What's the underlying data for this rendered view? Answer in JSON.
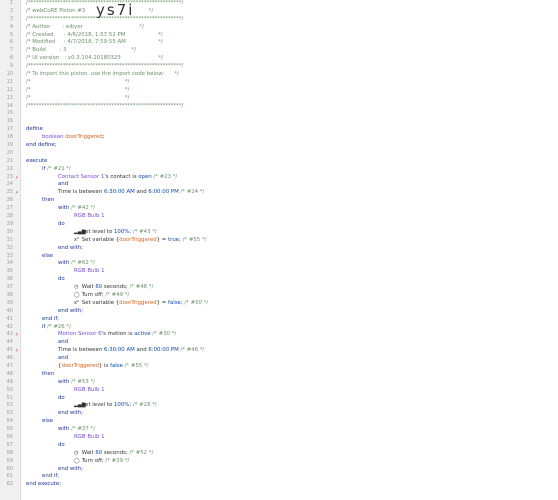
{
  "editor": {
    "import_code": "ys7i",
    "lines": [
      {
        "n": "1",
        "m": "",
        "ind": 0,
        "tokens": [
          [
            "cmt",
            "/*********************************************************/"
          ]
        ]
      },
      {
        "n": "2",
        "m": "",
        "ind": 0,
        "tokens": [
          [
            "cmt",
            "/* webCoRE Piston #3                                     */"
          ]
        ]
      },
      {
        "n": "3",
        "m": "",
        "ind": 0,
        "tokens": [
          [
            "cmt",
            "/*********************************************************/"
          ]
        ]
      },
      {
        "n": "4",
        "m": "",
        "ind": 0,
        "tokens": [
          [
            "cmt",
            "/* Author       : eibyer                                 */"
          ]
        ]
      },
      {
        "n": "5",
        "m": "",
        "ind": 0,
        "tokens": [
          [
            "cmt",
            "/* Created      : 4/6/2018, 1:57:52 PM                   */"
          ]
        ]
      },
      {
        "n": "6",
        "m": "",
        "ind": 0,
        "tokens": [
          [
            "cmt",
            "/* Modified     : 4/7/2018, 7:59:55 AM                   */"
          ]
        ]
      },
      {
        "n": "7",
        "m": "",
        "ind": 0,
        "tokens": [
          [
            "cmt",
            "/* Build        : 3                                      */"
          ]
        ]
      },
      {
        "n": "8",
        "m": "",
        "ind": 0,
        "tokens": [
          [
            "cmt",
            "/* UI version   : v0.3.104.20180323                      */"
          ]
        ]
      },
      {
        "n": "9",
        "m": "",
        "ind": 0,
        "tokens": [
          [
            "cmt",
            "/*********************************************************/"
          ]
        ]
      },
      {
        "n": "10",
        "m": "",
        "ind": 0,
        "tokens": [
          [
            "cmt",
            "/* To import this piston, use the import code below:      */"
          ]
        ]
      },
      {
        "n": "11",
        "m": "",
        "ind": 0,
        "tokens": [
          [
            "cmt",
            "/*                                                       */"
          ]
        ]
      },
      {
        "n": "12",
        "m": "",
        "ind": 0,
        "tokens": [
          [
            "cmt",
            "/*                                                       */"
          ]
        ]
      },
      {
        "n": "13",
        "m": "",
        "ind": 0,
        "tokens": [
          [
            "cmt",
            "/*                                                       */"
          ]
        ]
      },
      {
        "n": "14",
        "m": "",
        "ind": 0,
        "tokens": [
          [
            "cmt",
            "/*********************************************************/"
          ]
        ]
      },
      {
        "n": "15",
        "m": "",
        "ind": 0,
        "tokens": []
      },
      {
        "n": "16",
        "m": "",
        "ind": 0,
        "tokens": []
      },
      {
        "n": "17",
        "m": "",
        "ind": 0,
        "tokens": [
          [
            "kw",
            "define"
          ]
        ]
      },
      {
        "n": "18",
        "m": "",
        "ind": 1,
        "tokens": [
          [
            "tp",
            "boolean "
          ],
          [
            "var",
            "doorTriggered"
          ],
          [
            "op",
            ";"
          ]
        ]
      },
      {
        "n": "19",
        "m": "",
        "ind": 0,
        "tokens": [
          [
            "kw",
            "end define;"
          ]
        ]
      },
      {
        "n": "20",
        "m": "",
        "ind": 0,
        "tokens": []
      },
      {
        "n": "21",
        "m": "",
        "ind": 0,
        "tokens": [
          [
            "kw",
            "execute"
          ]
        ]
      },
      {
        "n": "22",
        "m": "",
        "ind": 1,
        "tokens": [
          [
            "kw",
            "if "
          ],
          [
            "cmt",
            "/* #21 */"
          ]
        ]
      },
      {
        "n": "23",
        "m": "⚡",
        "ind": 2,
        "tokens": [
          [
            "dev",
            "Contact Sensor 1"
          ],
          [
            "op",
            "'s contact is "
          ],
          [
            "val",
            "open"
          ],
          [
            "cmt",
            " /* #23 */"
          ]
        ]
      },
      {
        "n": "24",
        "m": "",
        "ind": 2,
        "tokens": [
          [
            "kw",
            "and"
          ]
        ]
      },
      {
        "n": "25",
        "m": "⚡",
        "ind": 2,
        "tokens": [
          [
            "op",
            "Time is between "
          ],
          [
            "val",
            "6:30:00 AM"
          ],
          [
            "op",
            " and "
          ],
          [
            "val",
            "6:00:00 PM"
          ],
          [
            "cmt",
            " /* #24 */"
          ]
        ]
      },
      {
        "n": "26",
        "m": "",
        "ind": 1,
        "tokens": [
          [
            "kw",
            "then"
          ]
        ]
      },
      {
        "n": "27",
        "m": "",
        "ind": 2,
        "tokens": [
          [
            "kw",
            "with "
          ],
          [
            "cmt",
            "/* #42 */"
          ]
        ]
      },
      {
        "n": "28",
        "m": "",
        "ind": 3,
        "tokens": [
          [
            "dev",
            "RGB Bulb 1"
          ]
        ]
      },
      {
        "n": "29",
        "m": "",
        "ind": 2,
        "tokens": [
          [
            "kw",
            "do"
          ]
        ]
      },
      {
        "n": "30",
        "m": "",
        "ind": 3,
        "tokens": [
          [
            "ico",
            "▂▄▆"
          ],
          [
            "op",
            " Set level to "
          ],
          [
            "val",
            "100%"
          ],
          [
            "op",
            ";"
          ],
          [
            "cmt",
            " /* #43 */"
          ]
        ]
      },
      {
        "n": "31",
        "m": "",
        "ind": 3,
        "tokens": [
          [
            "ico",
            "x²"
          ],
          [
            "op",
            " Set variable {"
          ],
          [
            "var",
            "doorTriggered"
          ],
          [
            "op",
            "} = "
          ],
          [
            "val",
            "true"
          ],
          [
            "op",
            ";"
          ],
          [
            "cmt",
            " /* #55 */"
          ]
        ]
      },
      {
        "n": "32",
        "m": "",
        "ind": 2,
        "tokens": [
          [
            "kw",
            "end with;"
          ]
        ]
      },
      {
        "n": "33",
        "m": "",
        "ind": 1,
        "tokens": [
          [
            "kw",
            "else"
          ]
        ]
      },
      {
        "n": "34",
        "m": "",
        "ind": 2,
        "tokens": [
          [
            "kw",
            "with "
          ],
          [
            "cmt",
            "/* #62 */"
          ]
        ]
      },
      {
        "n": "35",
        "m": "",
        "ind": 3,
        "tokens": [
          [
            "dev",
            "RGB Bulb 1"
          ]
        ]
      },
      {
        "n": "36",
        "m": "",
        "ind": 2,
        "tokens": [
          [
            "kw",
            "do"
          ]
        ]
      },
      {
        "n": "37",
        "m": "",
        "ind": 3,
        "tokens": [
          [
            "ico",
            "◷"
          ],
          [
            "op",
            " Wait "
          ],
          [
            "val",
            "60"
          ],
          [
            "op",
            " seconds;"
          ],
          [
            "cmt",
            " /* #48 */"
          ]
        ]
      },
      {
        "n": "38",
        "m": "",
        "ind": 3,
        "tokens": [
          [
            "ico",
            "◯"
          ],
          [
            "op",
            " Turn off;"
          ],
          [
            "cmt",
            " /* #49 */"
          ]
        ]
      },
      {
        "n": "39",
        "m": "",
        "ind": 3,
        "tokens": [
          [
            "ico",
            "x²"
          ],
          [
            "op",
            " Set variable {"
          ],
          [
            "var",
            "doorTriggered"
          ],
          [
            "op",
            "} = "
          ],
          [
            "val",
            "false"
          ],
          [
            "op",
            ";"
          ],
          [
            "cmt",
            " /* #50 */"
          ]
        ]
      },
      {
        "n": "40",
        "m": "",
        "ind": 2,
        "tokens": [
          [
            "kw",
            "end with;"
          ]
        ]
      },
      {
        "n": "41",
        "m": "",
        "ind": 1,
        "tokens": [
          [
            "kw",
            "end if;"
          ]
        ]
      },
      {
        "n": "42",
        "m": "",
        "ind": 1,
        "tokens": [
          [
            "kw",
            "if "
          ],
          [
            "cmt",
            "/* #26 */"
          ]
        ]
      },
      {
        "n": "43",
        "m": "⚡",
        "ind": 2,
        "tokens": [
          [
            "dev",
            "Motion Sensor 6"
          ],
          [
            "op",
            "'s motion is "
          ],
          [
            "val",
            "active"
          ],
          [
            "cmt",
            " /* #30 */"
          ]
        ]
      },
      {
        "n": "44",
        "m": "",
        "ind": 2,
        "tokens": [
          [
            "kw",
            "and"
          ]
        ]
      },
      {
        "n": "45",
        "m": "⚡",
        "ind": 2,
        "tokens": [
          [
            "op",
            "Time is between "
          ],
          [
            "val",
            "6:30:00 AM"
          ],
          [
            "op",
            " and "
          ],
          [
            "val",
            "6:00:00 PM"
          ],
          [
            "cmt",
            " /* #46 */"
          ]
        ]
      },
      {
        "n": "46",
        "m": "",
        "ind": 2,
        "tokens": [
          [
            "kw",
            "and"
          ]
        ]
      },
      {
        "n": "47",
        "m": "",
        "ind": 2,
        "tokens": [
          [
            "op",
            "{"
          ],
          [
            "var",
            "doorTriggered"
          ],
          [
            "op",
            "} is "
          ],
          [
            "val",
            "false"
          ],
          [
            "cmt",
            " /* #55 */"
          ]
        ]
      },
      {
        "n": "48",
        "m": "",
        "ind": 1,
        "tokens": [
          [
            "kw",
            "then"
          ]
        ]
      },
      {
        "n": "49",
        "m": "",
        "ind": 2,
        "tokens": [
          [
            "kw",
            "with "
          ],
          [
            "cmt",
            "/* #53 */"
          ]
        ]
      },
      {
        "n": "50",
        "m": "",
        "ind": 3,
        "tokens": [
          [
            "dev",
            "RGB Bulb 1"
          ]
        ]
      },
      {
        "n": "51",
        "m": "",
        "ind": 2,
        "tokens": [
          [
            "kw",
            "do"
          ]
        ]
      },
      {
        "n": "52",
        "m": "",
        "ind": 3,
        "tokens": [
          [
            "ico",
            "▂▄▆"
          ],
          [
            "op",
            " Set level to "
          ],
          [
            "val",
            "100%"
          ],
          [
            "op",
            ";"
          ],
          [
            "cmt",
            " /* #28 */"
          ]
        ]
      },
      {
        "n": "53",
        "m": "",
        "ind": 2,
        "tokens": [
          [
            "kw",
            "end with;"
          ]
        ]
      },
      {
        "n": "54",
        "m": "",
        "ind": 1,
        "tokens": [
          [
            "kw",
            "else"
          ]
        ]
      },
      {
        "n": "55",
        "m": "",
        "ind": 2,
        "tokens": [
          [
            "kw",
            "with "
          ],
          [
            "cmt",
            "/* #37 */"
          ]
        ]
      },
      {
        "n": "56",
        "m": "",
        "ind": 3,
        "tokens": [
          [
            "dev",
            "RGB Bulb 1"
          ]
        ]
      },
      {
        "n": "57",
        "m": "",
        "ind": 2,
        "tokens": [
          [
            "kw",
            "do"
          ]
        ]
      },
      {
        "n": "58",
        "m": "",
        "ind": 3,
        "tokens": [
          [
            "ico",
            "◷"
          ],
          [
            "op",
            " Wait "
          ],
          [
            "val",
            "60"
          ],
          [
            "op",
            " seconds;"
          ],
          [
            "cmt",
            " /* #52 */"
          ]
        ]
      },
      {
        "n": "59",
        "m": "",
        "ind": 3,
        "tokens": [
          [
            "ico",
            "◯"
          ],
          [
            "op",
            " Turn off;"
          ],
          [
            "cmt",
            " /* #39 */"
          ]
        ]
      },
      {
        "n": "60",
        "m": "",
        "ind": 2,
        "tokens": [
          [
            "kw",
            "end with;"
          ]
        ]
      },
      {
        "n": "61",
        "m": "",
        "ind": 1,
        "tokens": [
          [
            "kw",
            "end if;"
          ]
        ]
      },
      {
        "n": "62",
        "m": "",
        "ind": 0,
        "tokens": [
          [
            "kw",
            "end execute;"
          ]
        ]
      }
    ]
  }
}
